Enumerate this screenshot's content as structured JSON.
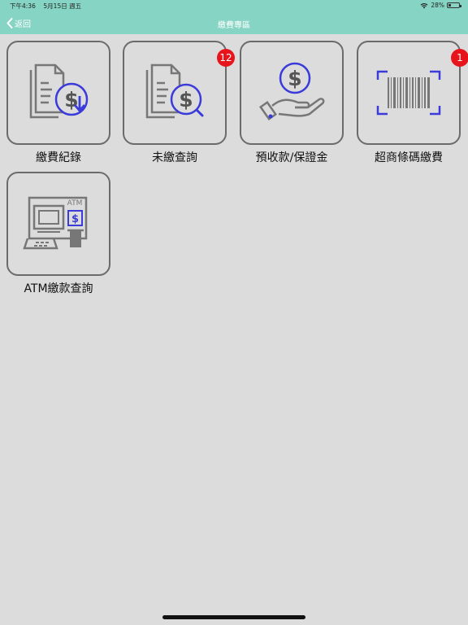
{
  "status_bar": {
    "time": "下午4:36",
    "date": "5月15日 週五",
    "battery_percent": "28%",
    "battery_level": 0.28
  },
  "nav": {
    "back_label": "返回",
    "title": "繳費專區"
  },
  "tiles": [
    {
      "label": "繳費紀錄",
      "icon": "payment-record-icon"
    },
    {
      "label": "未繳查詢",
      "icon": "unpaid-search-icon",
      "badge": "12"
    },
    {
      "label": "預收款/保證金",
      "icon": "deposit-hand-icon"
    },
    {
      "label": "超商條碼繳費",
      "icon": "barcode-icon",
      "badge": "1"
    },
    {
      "label": "ATM繳款查詢",
      "icon": "atm-icon"
    }
  ],
  "colors": {
    "header": "#86d4c3",
    "accent_blue": "#3b3bd9",
    "badge": "#e8141c"
  }
}
